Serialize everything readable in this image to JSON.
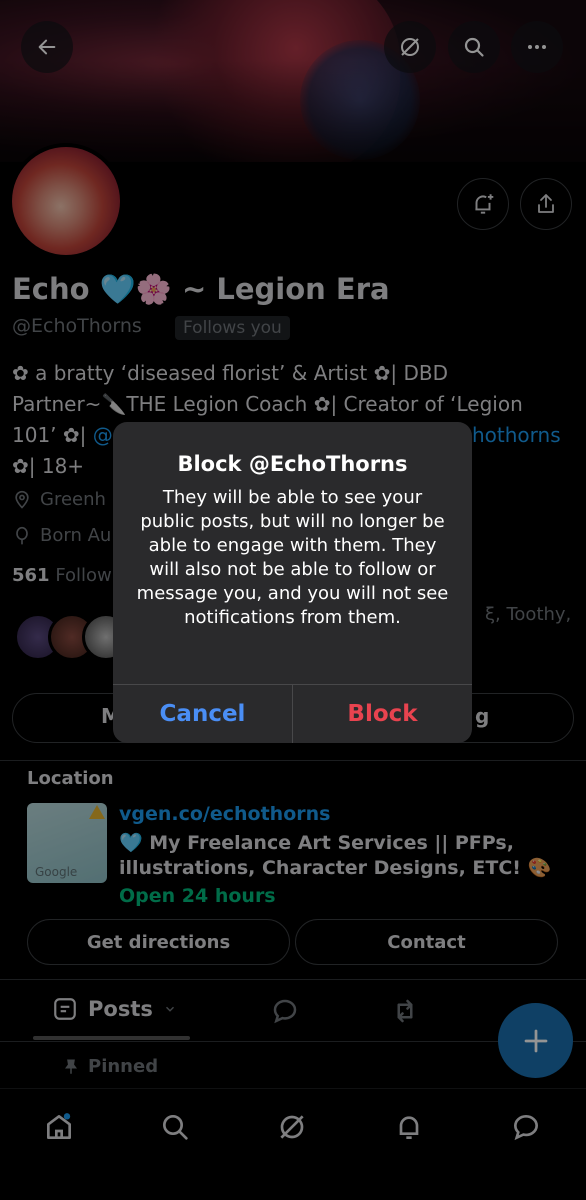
{
  "profile": {
    "name": "Echo 🩵🌸 ~ Legion Era",
    "handle": "@EchoThorns",
    "follows_badge": "Follows you",
    "bio_line1": "✿ a bratty ‘diseased florist’ & Artist ✿| DBD",
    "bio_line2": "Partner~🔪THE Legion Coach ✿| Creator of ‘Legion",
    "bio_line3_a": "101’ ✿| ",
    "bio_line3_link": "@",
    "bio_line3_link2": "hothorns",
    "bio_line4": "✿| 18+",
    "location_partial": "Greenh",
    "born_partial": "Born Au",
    "following_count": "561",
    "following_label": "Follow",
    "mutuals_partial": "ξ, Toothy,",
    "left_btn_partial": "M",
    "right_btn_partial": "g"
  },
  "location_card": {
    "title": "Location",
    "map_label": "Google",
    "url": "vgen.co/echothorns",
    "description": "🩵 My Freelance Art Services || PFPs, illustrations, Character Designs,  ETC! 🎨",
    "hours": "Open 24 hours",
    "directions_label": "Get directions",
    "contact_label": "Contact"
  },
  "tabs": {
    "posts_label": "Posts"
  },
  "pinned_label": "Pinned",
  "alert": {
    "title": "Block @EchoThorns",
    "message": "They will be able to see your public posts, but will no longer be able to engage with them. They will also not be able to follow or message you, and you will not see notifications from them.",
    "cancel_label": "Cancel",
    "block_label": "Block"
  },
  "colors": {
    "link": "#1d9bf0",
    "cancel": "#4a8ef5",
    "block": "#e8434f",
    "open": "#00ba7c",
    "fab": "#1a6fae"
  }
}
